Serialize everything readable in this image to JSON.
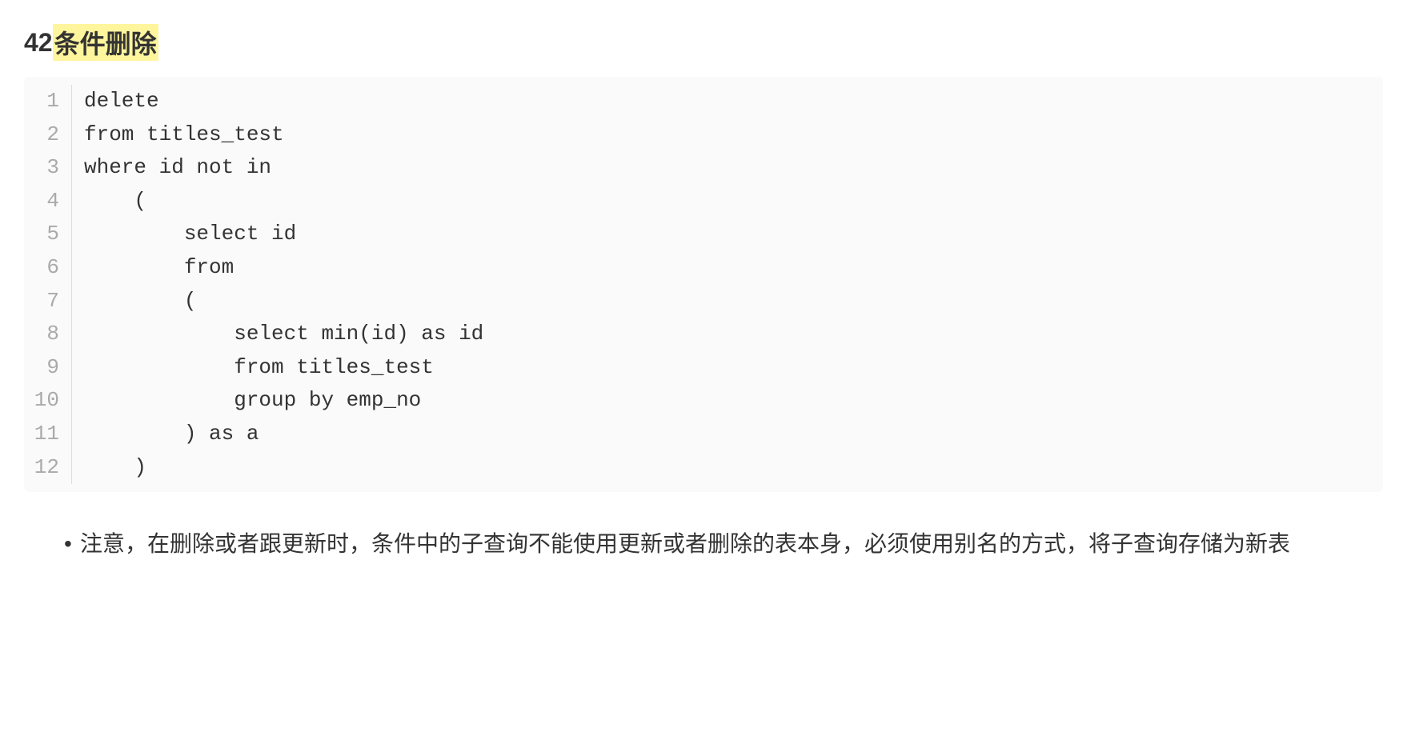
{
  "heading": {
    "number": "42",
    "title": "条件删除"
  },
  "code": {
    "lines": [
      "delete",
      "from titles_test",
      "where id not in",
      "    (",
      "        select id",
      "        from",
      "        (",
      "            select min(id) as id",
      "            from titles_test",
      "            group by emp_no",
      "        ) as a",
      "    )"
    ]
  },
  "notes": {
    "items": [
      "注意，在删除或者跟更新时，条件中的子查询不能使用更新或者删除的表本身，必须使用别名的方式，将子查询存储为新表"
    ]
  }
}
